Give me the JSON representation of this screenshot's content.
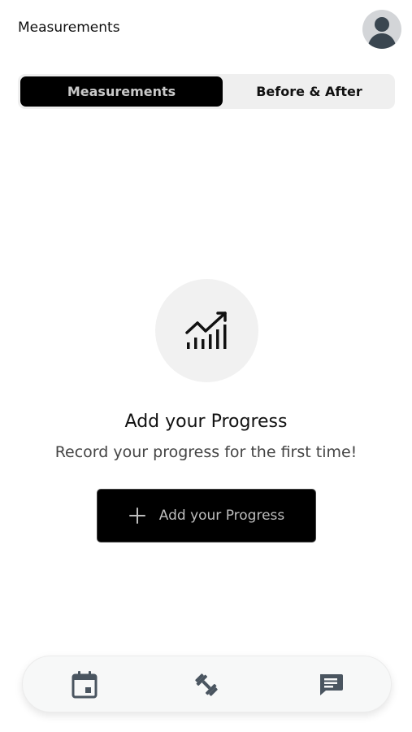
{
  "header": {
    "title": "Measurements"
  },
  "tabs": [
    {
      "label": "Measurements",
      "active": true
    },
    {
      "label": "Before & After",
      "active": false
    }
  ],
  "empty_state": {
    "icon": "chart-progress-icon",
    "title": "Add your Progress",
    "subtitle": "Record your progress for the first time!"
  },
  "add_button": {
    "label": "Add your Progress",
    "icon": "plus-icon"
  },
  "bottom_nav": {
    "items": [
      {
        "icon": "calendar-icon"
      },
      {
        "icon": "dumbbell-icon"
      },
      {
        "icon": "chat-icon"
      }
    ]
  },
  "colors": {
    "accent": "#000000",
    "icon": "#4a5560",
    "tab_track": "#efefef"
  }
}
